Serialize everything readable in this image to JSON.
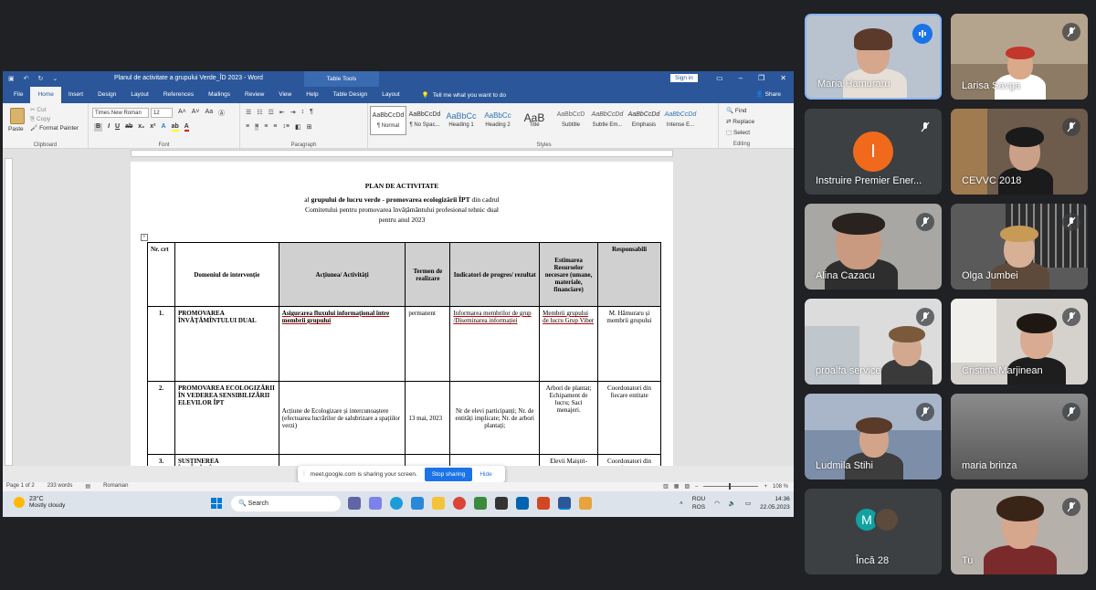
{
  "word": {
    "title": "Planul de activitate a grupului Verde_ÎD 2023  -  Word",
    "table_tools": "Table Tools",
    "sign_in": "Sign in",
    "tabs": [
      "File",
      "Home",
      "Insert",
      "Design",
      "Layout",
      "References",
      "Mailings",
      "Review",
      "View",
      "Help",
      "Table Design",
      "Layout"
    ],
    "tell_me": "Tell me what you want to do",
    "share": "Share",
    "clipboard": {
      "paste": "Paste",
      "cut": "Cut",
      "copy": "Copy",
      "format_painter": "Format Painter",
      "label": "Clipboard"
    },
    "font": {
      "name": "Times New Roman",
      "size": "12",
      "label": "Font"
    },
    "paragraph_label": "Paragraph",
    "styles": [
      {
        "sample": "AaBbCcDd",
        "name": "¶ Normal"
      },
      {
        "sample": "AaBbCcDd",
        "name": "¶ No Spac..."
      },
      {
        "sample": "AaBbCc",
        "name": "Heading 1"
      },
      {
        "sample": "AaBbCc",
        "name": "Heading 2"
      },
      {
        "sample": "AaB",
        "name": "Title"
      },
      {
        "sample": "AaBbCcD",
        "name": "Subtitle"
      },
      {
        "sample": "AaBbCcDd",
        "name": "Subtle Em..."
      },
      {
        "sample": "AaBbCcDd",
        "name": "Emphasis"
      },
      {
        "sample": "AaBbCcDd",
        "name": "Intense E..."
      }
    ],
    "styles_label": "Styles",
    "editing": {
      "find": "Find",
      "replace": "Replace",
      "select": "Select",
      "label": "Editing"
    },
    "status": {
      "page": "Page 1 of 2",
      "words": "233 words",
      "language": "Romanian",
      "zoom": "108 %"
    }
  },
  "document": {
    "title": "PLAN DE ACTIVITATE",
    "line2_prefix": "al ",
    "line2_bold": "grupului de lucru verde - promovarea ecologizării ÎPT",
    "line2_suffix": " din cadrul",
    "line3": "Comitetului pentru promovarea învățământului profesional tehnic dual",
    "line4": "pentru anul 2023",
    "headers": [
      "Nr. crt",
      "Domeniul de intervenție",
      "Acțiunea/ Activități",
      "Termen de realizare",
      "Indicatori de progres/ rezultat",
      "Estimarea Resurselor necesare (umane, materiale, financiare)",
      "Responsabili"
    ],
    "rows": [
      {
        "nr": "1.",
        "domain": "PROMOVAREA ÎNVĂȚĂMÎNTULUI DUAL",
        "action": "Asigurarea fluxului informațional între membrii grupului",
        "term": "permanent",
        "indicators": "Informarea membrilor de grup /Diseminarea informației",
        "resources": "Membrii grupului de lucru Grup Viber",
        "responsible": "M. Hămuraru și membrii grupului"
      },
      {
        "nr": "2.",
        "domain": "PROMOVAREA ECOLOGIZĂRII ÎN VEDEREA SENSIBILIZĂRII ELEVILOR ÎPT",
        "action": "Acțiune de Ecologizare și intercunoaștere (efectuarea lucrărilor de salubrizare a spațiilor verzi)",
        "term": "13 mai, 2023",
        "indicators": "Nr de elevi participanți; Nr. de entități implicate; Nr. de arbori plantați;",
        "resources": "Arbori de plantat; Echipament de lucru; Saci menajeri.",
        "responsible": "Coordonatori din fiecare entitate"
      },
      {
        "nr": "3.",
        "domain": "SUSȚINEREA ÎNVĂȚĂMÎNTULUI DUAL DIN PARTEA",
        "action": "",
        "term": "",
        "indicators": "",
        "resources": "Elevii Maiștri-",
        "responsible": "Coordonatori din fiecare"
      }
    ]
  },
  "sharing_bar": {
    "text": "meet.google.com is sharing your screen.",
    "stop": "Stop sharing",
    "hide": "Hide"
  },
  "taskbar": {
    "temp": "23°C",
    "weather": "Mostly cloudy",
    "search": "Search",
    "lang1": "ROU",
    "lang2": "ROS",
    "time": "14:36",
    "date": "22.05.2023"
  },
  "participants": [
    {
      "name": "Maria Hamuraru",
      "speaking": true
    },
    {
      "name": "Larisa Savga",
      "muted": true
    },
    {
      "name": "Instruire Premier Ener...",
      "initial": "I",
      "muted": true
    },
    {
      "name": "CEVVC 2018",
      "muted": true
    },
    {
      "name": "Alina Cazacu",
      "muted": true
    },
    {
      "name": "Olga Jumbei",
      "muted": true
    },
    {
      "name": "proalfa service",
      "muted": true
    },
    {
      "name": "Cristina Marjinean",
      "muted": true
    },
    {
      "name": "Ludmila Stihi",
      "muted": true
    },
    {
      "name": "maria brinza",
      "muted": true
    },
    {
      "name": "Încă 28",
      "avatar_initial": "M"
    },
    {
      "name": "Tu",
      "muted": true
    }
  ],
  "colors": {
    "word_blue": "#2b579a",
    "meet_bg": "#202124",
    "accent": "#1a73e8",
    "avatar_orange": "#f16a1b"
  }
}
